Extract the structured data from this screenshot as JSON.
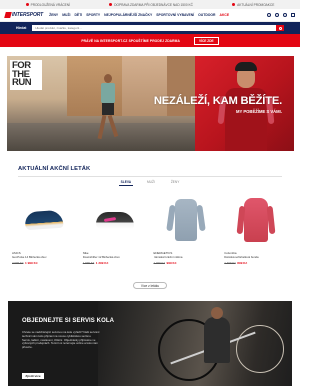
{
  "infobar": {
    "items": [
      "PRODLOUŽENÁ VRÁCENÍ",
      "DOPRAVA ZDARMA PŘI OBJEDNÁVCE NAD 1500 KČ",
      "AKTUÁLNÍ PROMOAKCE"
    ]
  },
  "header": {
    "logo_text": "INTERSPORT",
    "nav": [
      "ŽENY",
      "MUŽI",
      "DĚTI",
      "SPORTY",
      "NEJPOPULÁRNĚJŠÍ ZNAČKY",
      "SPORTOVNÍ VYBAVENÍ",
      "OUTDOOR",
      "AKCE"
    ]
  },
  "search": {
    "label": "Hledat",
    "placeholder": "Hledat produkt, značku, kategorii..."
  },
  "promo": {
    "text": "PRÁVĚ NA INTERSPORT.CZ SPOUŠTÍME PRODEJ ZDARMA",
    "cta": "VÍCE ZDE"
  },
  "hero": {
    "badge_lines": [
      "FOR",
      "THE",
      "RUN"
    ],
    "headline": "NEZÁLEŽÍ, KAM BĚŽÍTE.",
    "subline": "MY POBĚŽÍME S VÁMI."
  },
  "leaflet": {
    "title": "AKTUÁLNÍ AKČNÍ LETÁK",
    "filters": [
      "SLEVA",
      "MUŽI",
      "ŽENY"
    ],
    "products": [
      {
        "brand": "ASICS",
        "name": "Gel-Pulse 14 Běžecká obuv",
        "old_price": "2 999 Kč",
        "new_price": "1 999 Kč"
      },
      {
        "brand": "Nike",
        "name": "Downshifter 12 Běžecká obuv",
        "old_price": "1 999 Kč",
        "new_price": "1 299 Kč"
      },
      {
        "brand": "ENERGETICS",
        "name": "Dámská funkční mikina",
        "old_price": "1 499 Kč",
        "new_price": "999 Kč"
      },
      {
        "brand": "Columbia",
        "name": "Dámská softshellová bunda",
        "old_price": "1 499 Kč",
        "new_price": "899 Kč"
      }
    ],
    "more_label": "Více z letáku"
  },
  "bike": {
    "title": "OBJEDNEJTE SI SERVIS KOLA",
    "description": "Chcete se nadcházející sezónou na kole vyřazit? Naši servisní technici vám kolo připraví na novou cyklistickou sezónu. Servis, ladění, nastavení, čištění. Objednávky přijímáme ve vybraných prodejnách. Termín si rezervujte online a kolo nám přivezte.",
    "cta": "Zjistit více"
  },
  "colors": {
    "brand_red": "#e30613",
    "brand_navy": "#12245a"
  }
}
